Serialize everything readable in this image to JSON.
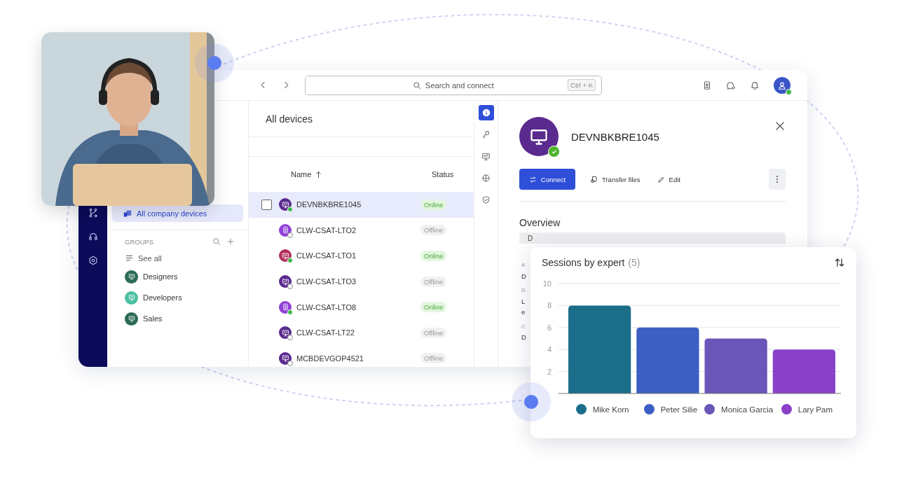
{
  "topbar": {
    "search": {
      "placeholder": "Search and connect",
      "shortcut": "Ctrl + K"
    }
  },
  "groups_panel": {
    "all_devices": {
      "label": "All company devices",
      "selected": true
    },
    "groups_label": "GROUPS",
    "see_all": "See all",
    "groups": [
      {
        "name": "Designers",
        "color": "#2b6b57"
      },
      {
        "name": "Developers",
        "color": "#4cbfa0"
      },
      {
        "name": "Sales",
        "color": "#2b6b57"
      }
    ]
  },
  "device_list": {
    "title": "All devices",
    "columns": [
      "Name",
      "Status"
    ],
    "rows": [
      {
        "name": "DEVNBKBRE1045",
        "status": "Online",
        "online": true,
        "selected": true,
        "color": "#5a2a8e",
        "kind": "monitor"
      },
      {
        "name": "CLW-CSAT-LTO2",
        "status": "Offline",
        "online": false,
        "selected": false,
        "color": "#9140d8",
        "kind": "phone"
      },
      {
        "name": "CLW-CSAT-LTO1",
        "status": "Online",
        "online": true,
        "selected": false,
        "color": "#b3305c",
        "kind": "display"
      },
      {
        "name": "CLW-CSAT-LTO3",
        "status": "Offline",
        "online": false,
        "selected": false,
        "color": "#5a2a8e",
        "kind": "monitor"
      },
      {
        "name": "CLW-CSAT-LTO8",
        "status": "Online",
        "online": true,
        "selected": false,
        "color": "#9140d8",
        "kind": "phone"
      },
      {
        "name": "CLW-CSAT-LT22",
        "status": "Offline",
        "online": false,
        "selected": false,
        "color": "#5a2a8e",
        "kind": "monitor"
      },
      {
        "name": "MCBDEVGOP4521",
        "status": "Offline",
        "online": false,
        "selected": false,
        "color": "#5a2a8e",
        "kind": "monitor"
      }
    ]
  },
  "detail_tabs": [
    {
      "kind": "info",
      "selected": true
    },
    {
      "kind": "key",
      "selected": false
    },
    {
      "kind": "monitor",
      "selected": false
    },
    {
      "kind": "grid",
      "selected": false
    },
    {
      "kind": "shield",
      "selected": false
    }
  ],
  "device": {
    "name": "DEVNBKBRE1045",
    "online": true,
    "actions": [
      {
        "label": "Connect",
        "kind": "primary"
      },
      {
        "label": "Transfer files",
        "kind": "transfer"
      },
      {
        "label": "Edit",
        "kind": "edit"
      }
    ],
    "section": "Overview",
    "info_header": "D",
    "fragments": [
      {
        "text": "A",
        "kind": "label"
      },
      {
        "text": "D",
        "kind": "value"
      },
      {
        "text": "D",
        "kind": "label"
      },
      {
        "text": "L",
        "kind": "value"
      },
      {
        "text": "e",
        "kind": "value"
      },
      {
        "text": "C",
        "kind": "label"
      },
      {
        "text": "D",
        "kind": "value"
      }
    ]
  },
  "chart_card": {
    "title": "Sessions by expert",
    "count": "(5)",
    "chart_data": {
      "type": "bar",
      "values": [
        8,
        6,
        5,
        4
      ],
      "ylim": [
        0,
        10
      ],
      "yticks": [
        2,
        4,
        6,
        8,
        10
      ],
      "grid": true
    },
    "legend": [
      {
        "name": "Mike Korn",
        "color": "#1b6e8a"
      },
      {
        "name": "Peter Silie",
        "color": "#3d5fc4"
      },
      {
        "name": "Monica Garcia",
        "color": "#6a55b8"
      },
      {
        "name": "Lary Pam",
        "color": "#8a40c8"
      }
    ]
  }
}
